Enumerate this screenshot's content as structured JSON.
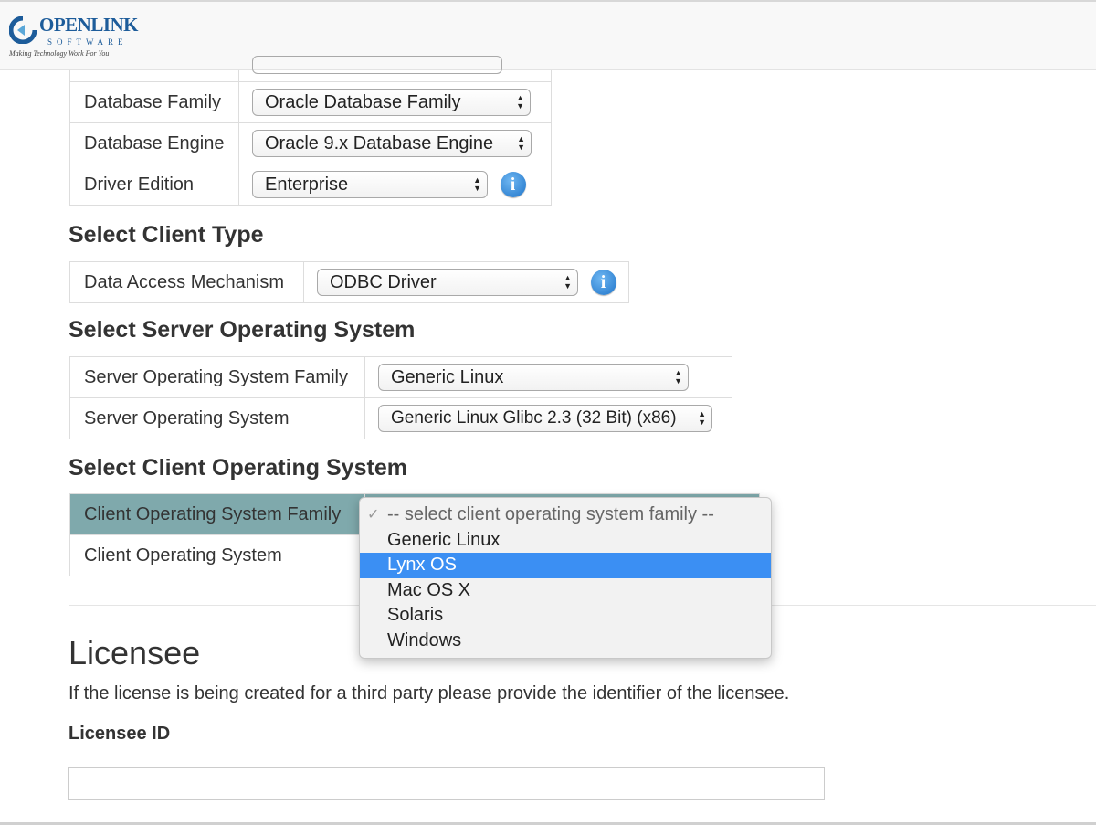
{
  "header": {
    "logo": {
      "name": "OPENLINK",
      "subname": "SOFTWARE",
      "tagline": "Making Technology Work For You"
    }
  },
  "product_table": {
    "rows": [
      {
        "label": "Database Family",
        "value": "Oracle Database Family",
        "info": false
      },
      {
        "label": "Database Engine",
        "value": "Oracle 9.x Database Engine",
        "info": false
      },
      {
        "label": "Driver Edition",
        "value": "Enterprise",
        "info": true
      }
    ]
  },
  "client_type": {
    "heading": "Select Client Type",
    "rows": [
      {
        "label": "Data Access Mechanism",
        "value": "ODBC Driver",
        "info": true
      }
    ]
  },
  "server_os": {
    "heading": "Select Server Operating System",
    "rows": [
      {
        "label": "Server Operating System Family",
        "value": "Generic Linux"
      },
      {
        "label": "Server Operating System",
        "value": "Generic Linux Glibc 2.3 (32 Bit) (x86)"
      }
    ]
  },
  "client_os": {
    "heading": "Select Client Operating System",
    "rows": [
      {
        "label": "Client Operating System Family"
      },
      {
        "label": "Client Operating System"
      }
    ],
    "dropdown": {
      "options": [
        "-- select client operating system family --",
        "Generic Linux",
        "Lynx OS",
        "Mac OS X",
        "Solaris",
        "Windows"
      ],
      "checked_index": 0,
      "highlighted_index": 2
    }
  },
  "licensee": {
    "heading": "Licensee",
    "help_text": "If the license is being created for a third party please provide the identifier of the licensee.",
    "field_label": "Licensee ID",
    "field_value": ""
  },
  "colors": {
    "highlight_row": "#7fa9ac",
    "selected_option": "#3b8ff3",
    "info_icon": "#1f74c9",
    "logo": "#1d5c9a"
  }
}
